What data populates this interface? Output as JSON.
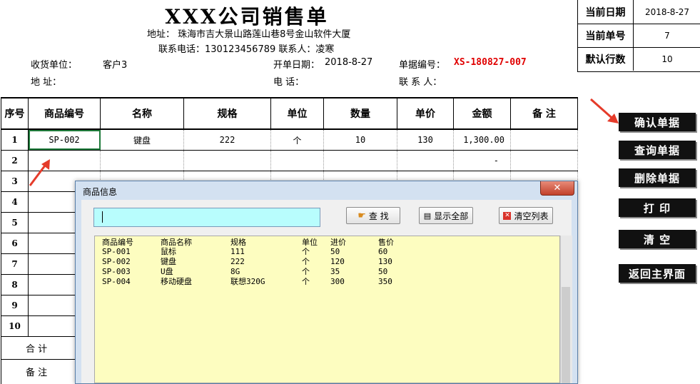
{
  "header": {
    "title": "XXX公司销售单",
    "address": "地址： 珠海市吉大景山路莲山巷8号金山软件大厦",
    "contact": "联系电话：130123456789  联系人：凌寒",
    "receiver_label": "收货单位：",
    "receiver_value": "客户3",
    "address_label": "地    址：",
    "open_date_label": "开单日期：",
    "open_date_value": "2018-8-27",
    "phone_label": "电      话：",
    "doc_no_label": "单据编号：",
    "doc_no_value": "XS-180827-007",
    "contact_person_label": "联  系  人："
  },
  "info": [
    {
      "label": "当前日期",
      "value": "2018-8-27"
    },
    {
      "label": "当前单号",
      "value": "7"
    },
    {
      "label": "默认行数",
      "value": "10"
    }
  ],
  "table": {
    "columns": [
      "序号",
      "商品编号",
      "名称",
      "规格",
      "单位",
      "数量",
      "单价",
      "金额",
      "备  注"
    ],
    "rows": [
      {
        "no": "1",
        "code": "SP-002",
        "name": "键盘",
        "spec": "222",
        "unit": "个",
        "qty": "10",
        "price": "130",
        "amount": "1,300.00",
        "note": ""
      },
      {
        "no": "2",
        "code": "",
        "name": "",
        "spec": "",
        "unit": "",
        "qty": "",
        "price": "",
        "amount": "-",
        "note": ""
      },
      {
        "no": "3"
      },
      {
        "no": "4"
      },
      {
        "no": "5"
      },
      {
        "no": "6"
      },
      {
        "no": "7"
      },
      {
        "no": "8"
      },
      {
        "no": "9"
      },
      {
        "no": "10"
      }
    ],
    "total_label": "合    计",
    "remark_label": "备    注"
  },
  "buttons": {
    "confirm": "确认单据",
    "query": "查询单据",
    "delete": "删除单据",
    "print": "打  印",
    "clear": "清  空",
    "back": "返回主界面"
  },
  "dialog": {
    "title": "商品信息",
    "search_value": "",
    "search_button": "查  找",
    "show_all_button": "显示全部",
    "clear_list_button": "清空列表",
    "list_headers": [
      "商品编号",
      "商品名称",
      "规格",
      "单位",
      "进价",
      "售价"
    ],
    "items": [
      [
        "SP-001",
        "鼠标",
        "111",
        "个",
        "50",
        "60"
      ],
      [
        "SP-002",
        "键盘",
        "222",
        "个",
        "120",
        "130"
      ],
      [
        "SP-003",
        "U盘",
        "8G",
        "个",
        "35",
        "50"
      ],
      [
        "SP-004",
        "移动硬盘",
        "联想320G",
        "个",
        "300",
        "350"
      ]
    ]
  },
  "colors": {
    "accent_red": "#e00000",
    "dialog_list_bg": "#fdfdc0",
    "search_bg": "#b8fdfd",
    "button_bg": "#111111"
  }
}
